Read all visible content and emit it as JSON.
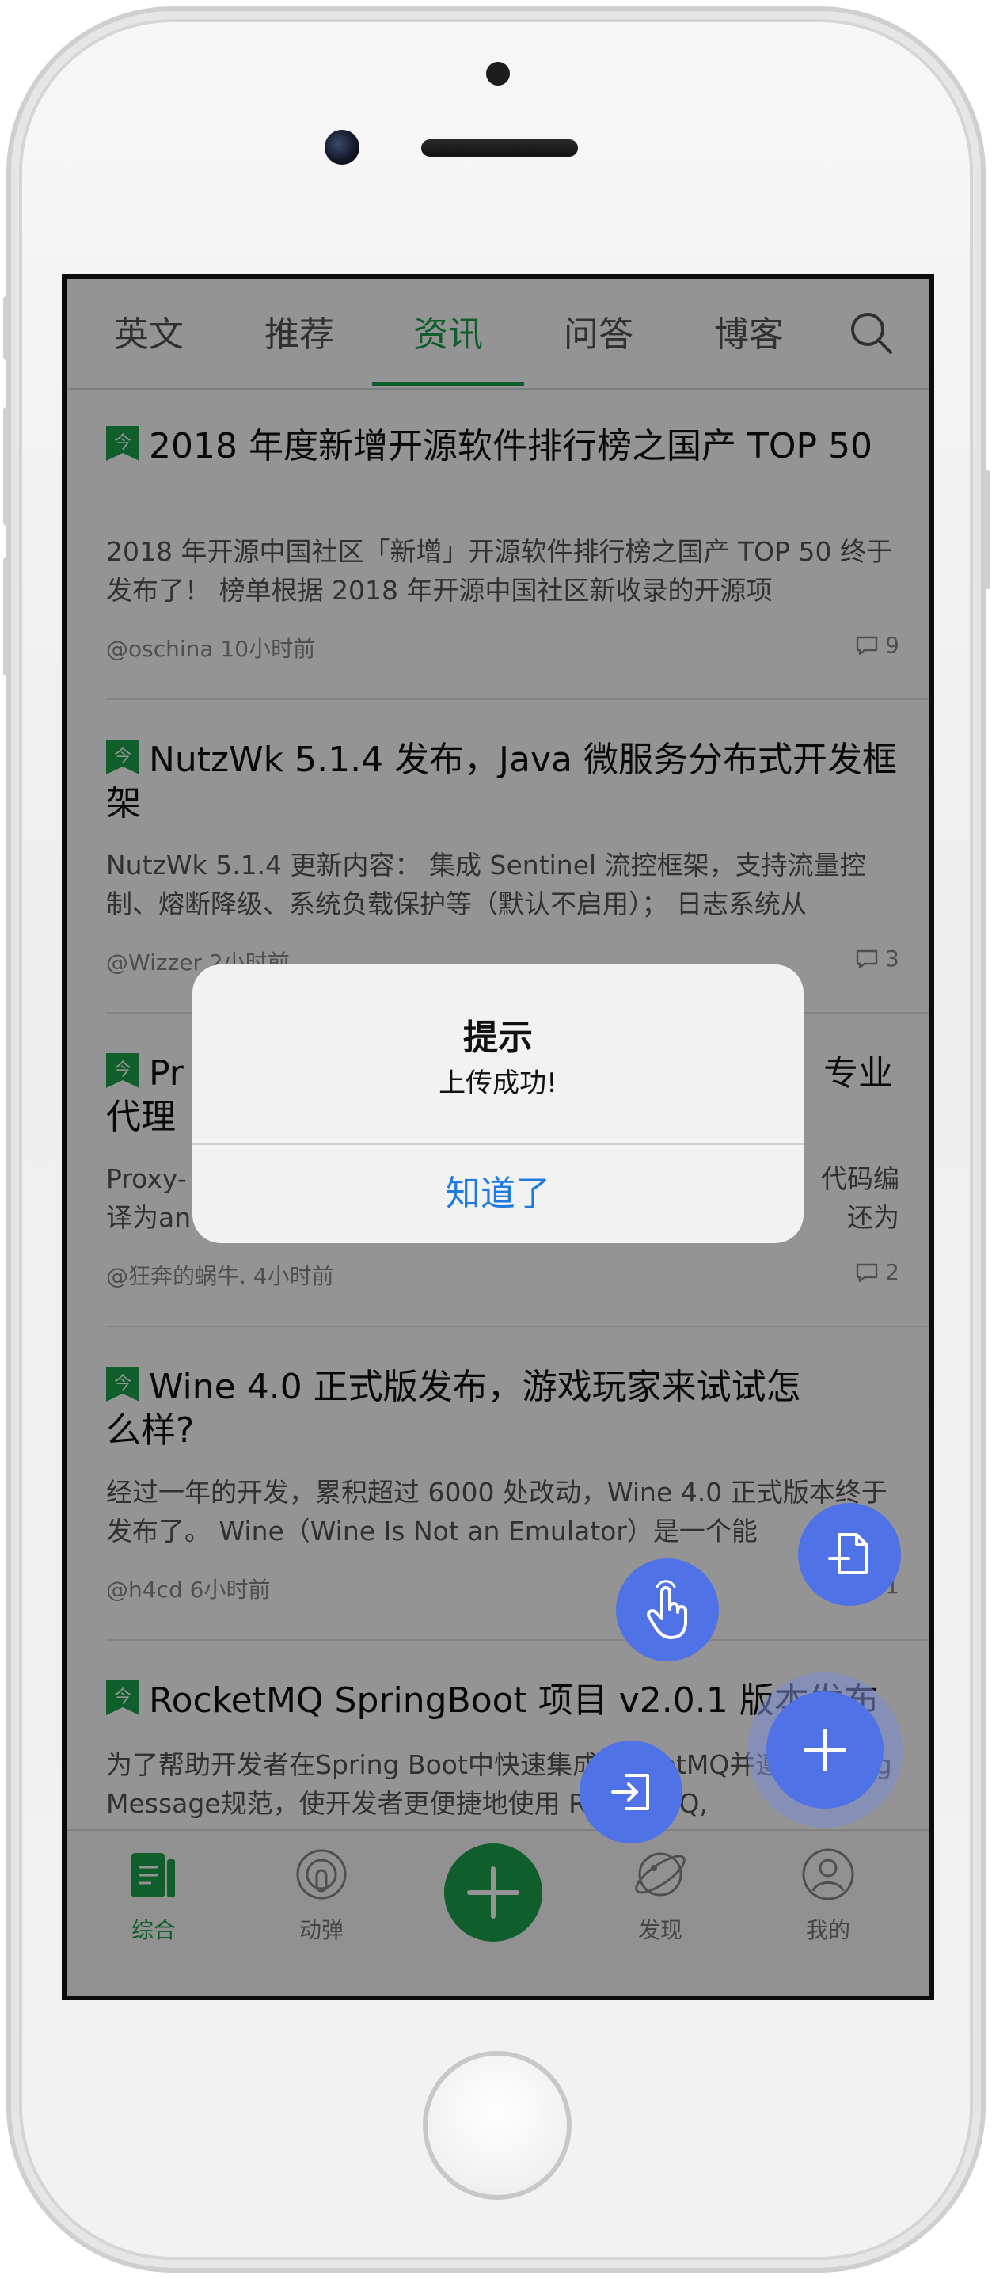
{
  "tabs": [
    {
      "label": "英文"
    },
    {
      "label": "推荐"
    },
    {
      "label": "资讯",
      "active": true
    },
    {
      "label": "问答"
    },
    {
      "label": "博客"
    }
  ],
  "articles": [
    {
      "title": "2018 年度新增开源软件排行榜之国产 TOP 50",
      "summary": "2018 年开源中国社区「新增」开源软件排行榜之国产 TOP 50 终于发布了！ 榜单根据 2018 年开源中国社区新收录的开源项",
      "meta": "@oschina 10小时前",
      "count": "9"
    },
    {
      "title": "NutzWk 5.1.4 发布，Java 微服务分布式开发框架",
      "summary": "NutzWk 5.1.4 更新内容： 集成 Sentinel 流控框架，支持流量控制、熔断降级、系统负载保护等（默认不启用）； 日志系统从",
      "meta": "@Wizzer 2小时前",
      "count": "3"
    },
    {
      "title": "Proxy-… 专业代理",
      "title_left": "Pr",
      "title_right": "专业",
      "title_line2": "代理",
      "summary_left": "Proxy-",
      "summary_right": "代码编",
      "summary_left2": "译为an",
      "summary_right2": "还为",
      "meta": "@狂奔的蜗牛. 4小时前",
      "count": "2"
    },
    {
      "title": "Wine 4.0 正式版发布，游戏玩家来试试怎么样?",
      "summary": "经过一年的开发，累积超过 6000 处改动，Wine 4.0 正式版本终于发布了。 Wine（Wine Is Not an Emulator）是一个能",
      "meta": "@h4cd 6小时前",
      "count": "1"
    },
    {
      "title": "RocketMQ SpringBoot 项目 v2.0.1 版本发布",
      "summary": "为了帮助开发者在Spring Boot中快速集成RocketMQ并遵循Spring Message规范，使开发者更便捷地使用 RocketMQ,",
      "meta": "",
      "count": ""
    }
  ],
  "bottom_nav": [
    {
      "label": "综合",
      "icon": "document-icon",
      "active": true
    },
    {
      "label": "动弹",
      "icon": "podcast-icon"
    },
    {
      "label": "",
      "icon": "plus-icon"
    },
    {
      "label": "发现",
      "icon": "planet-icon"
    },
    {
      "label": "我的",
      "icon": "user-icon"
    }
  ],
  "alert": {
    "title": "提示",
    "message": "上传成功!",
    "button": "知道了"
  },
  "colors": {
    "accent": "#1aa34a",
    "fab": "#4f72e6",
    "link": "#1f7ae0"
  }
}
